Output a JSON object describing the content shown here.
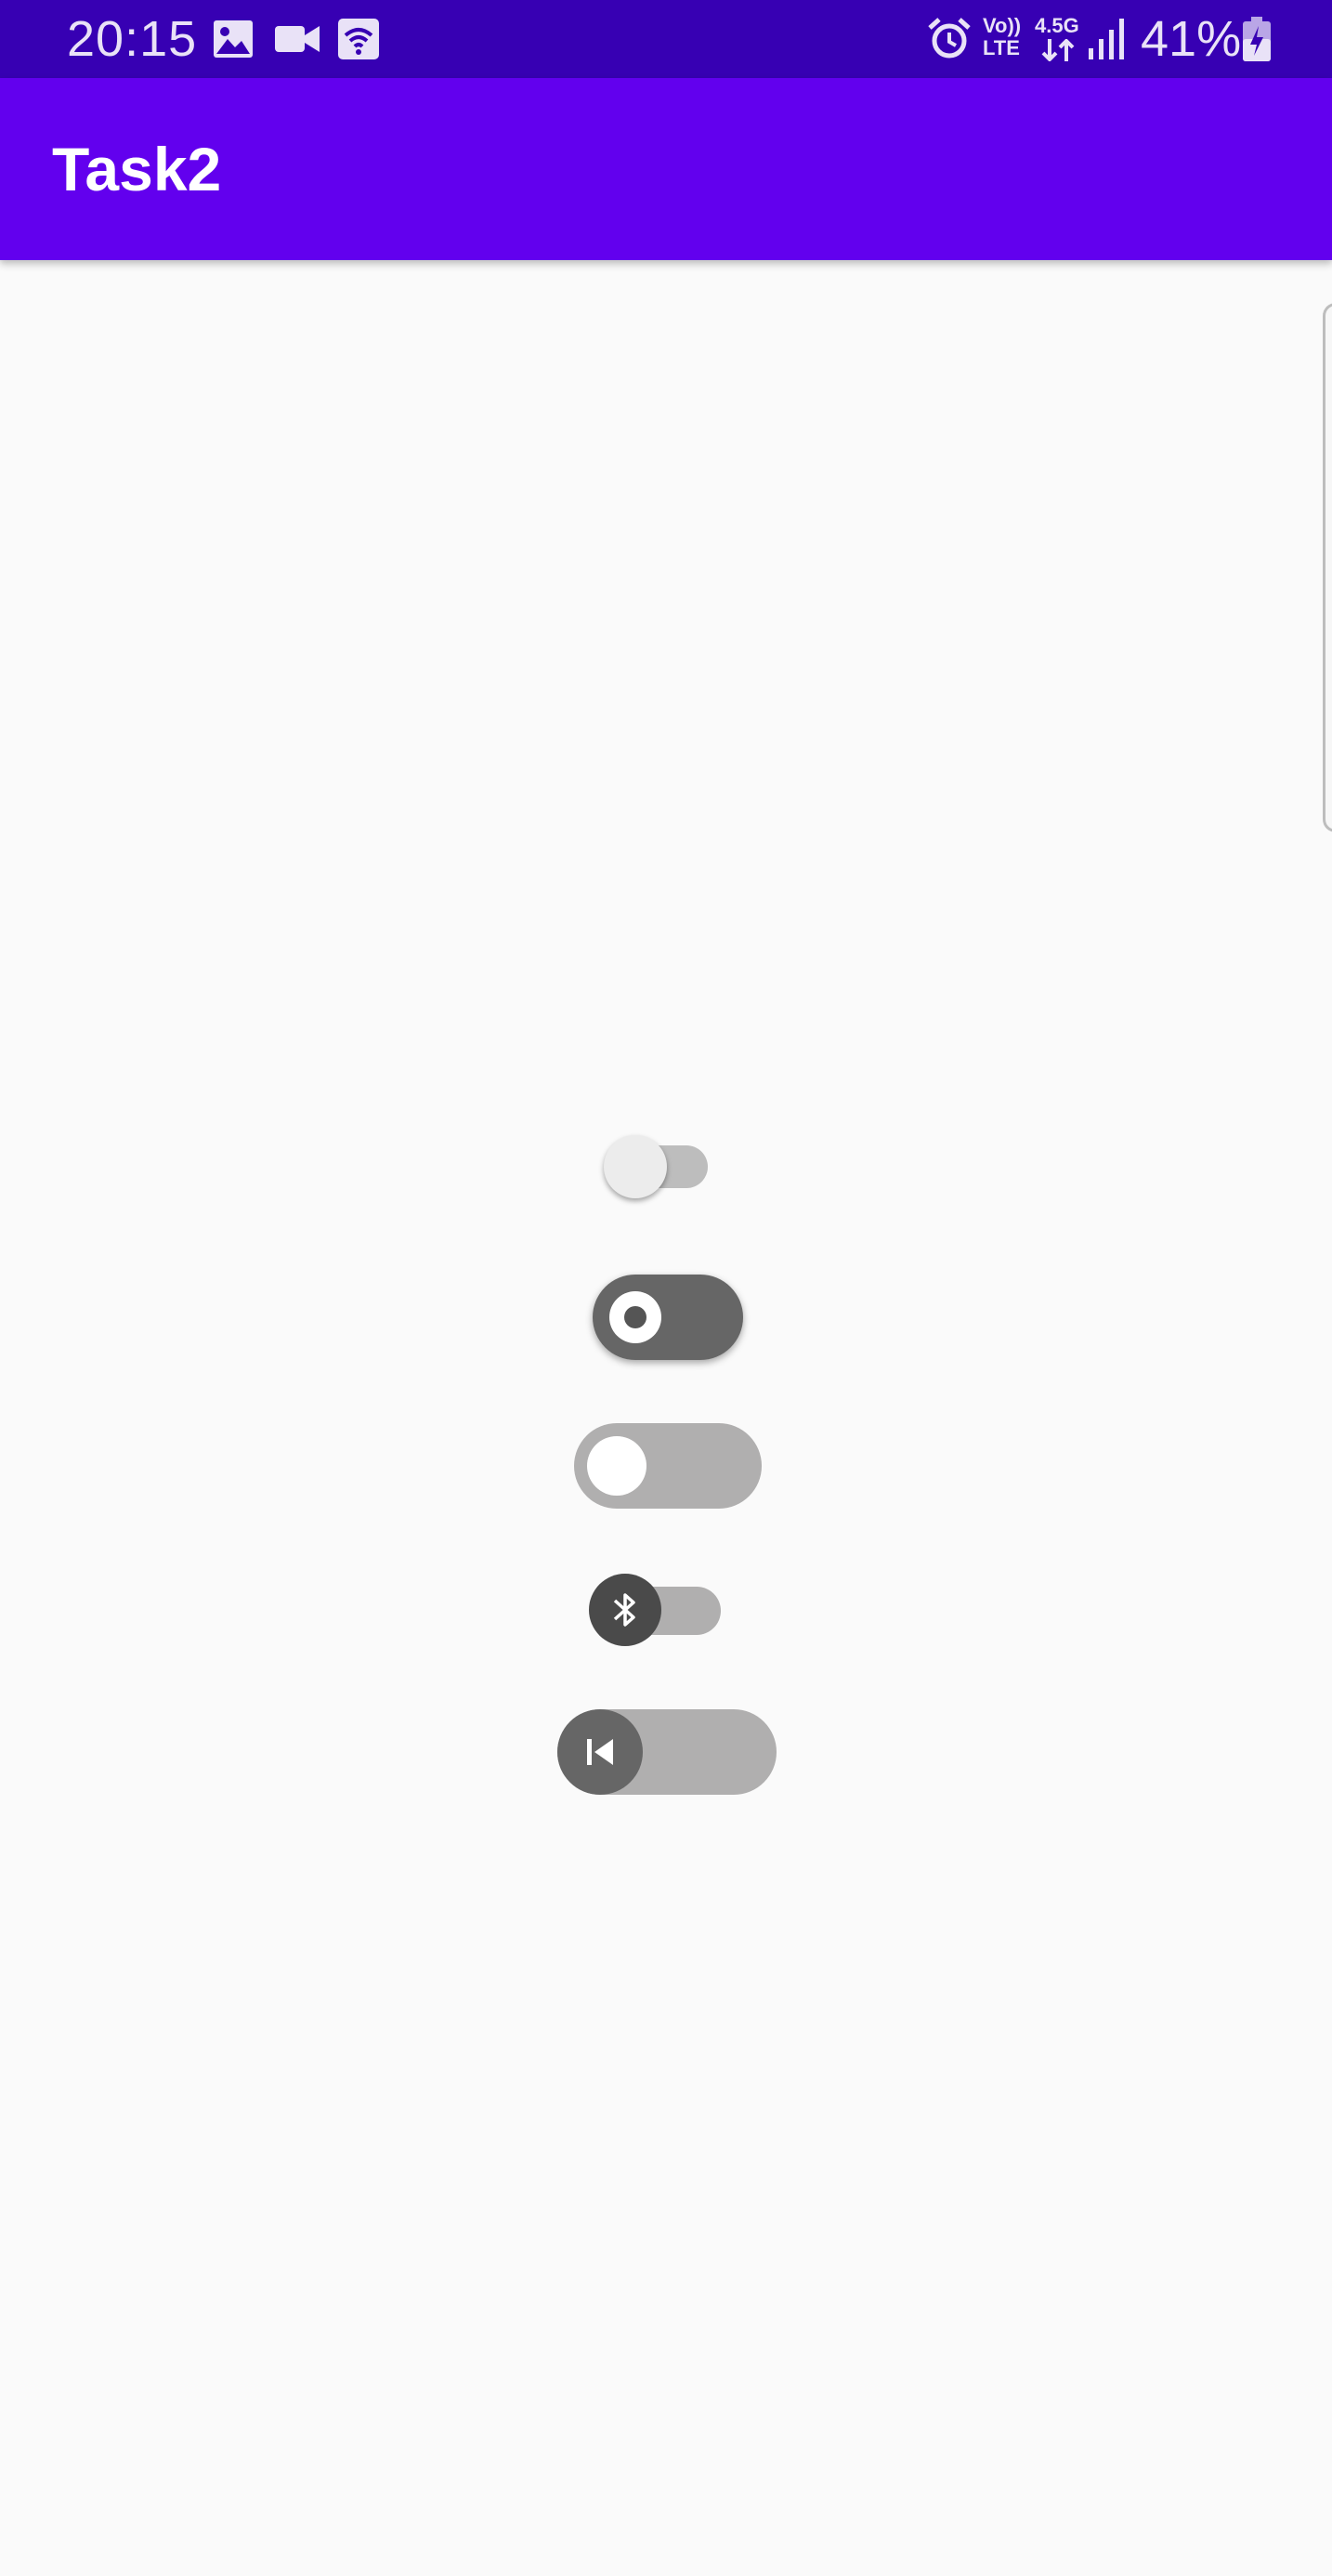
{
  "status_bar": {
    "time": "20:15",
    "battery_percent": "41%",
    "volte_top": "Vo))",
    "volte_bottom": "LTE",
    "network_type": "4.5G",
    "left_icons": [
      "gallery-icon",
      "video-camera-icon",
      "wifi-calling-icon"
    ],
    "right_icons": [
      "alarm-icon",
      "volte-icon",
      "data-transfer-icon",
      "signal-strength-icon",
      "battery-charging-icon"
    ]
  },
  "app_bar": {
    "title": "Task2",
    "background_color": "#6200EE"
  },
  "colors": {
    "status_bar": "#3700B3",
    "background": "#FAFAFA",
    "switch_track_light": "#B0AFAF",
    "switch_track_dark": "#666666"
  },
  "switches": [
    {
      "name": "default-switch",
      "checked": false
    },
    {
      "name": "ring-thumb-switch",
      "checked": false
    },
    {
      "name": "outlined-thumb-switch",
      "checked": false
    },
    {
      "name": "bluetooth-switch",
      "checked": false,
      "thumb_icon": "bluetooth-icon"
    },
    {
      "name": "skip-previous-switch",
      "checked": false,
      "thumb_icon": "skip-previous-icon"
    }
  ]
}
